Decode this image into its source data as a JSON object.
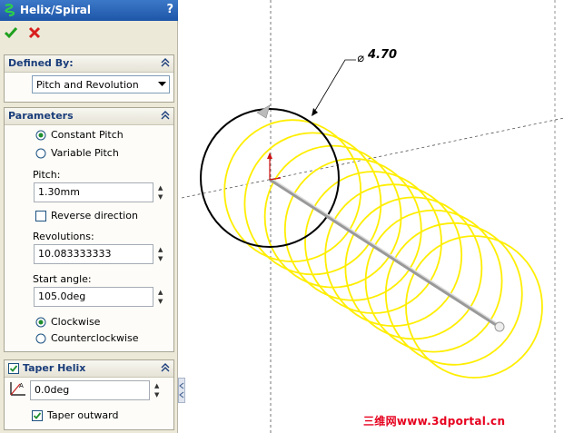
{
  "panel": {
    "title": "Helix/Spiral",
    "help": "?",
    "defined_by": {
      "heading": "Defined By:",
      "selected": "Pitch and Revolution"
    },
    "parameters": {
      "heading": "Parameters",
      "constant_pitch": "Constant Pitch",
      "variable_pitch": "Variable Pitch",
      "pitch_label": "Pitch:",
      "pitch_value": "1.30mm",
      "reverse_label": "Reverse direction",
      "revolutions_label": "Revolutions:",
      "revolutions_value": "10.083333333",
      "start_angle_label": "Start angle:",
      "start_angle_value": "105.0deg",
      "clockwise": "Clockwise",
      "counterclockwise": "Counterclockwise"
    },
    "taper": {
      "heading": "Taper Helix",
      "angle_value": "0.0deg",
      "outward_label": "Taper outward"
    }
  },
  "viewport": {
    "dimension_label": "4.70",
    "helix_color": "#ffee00"
  },
  "watermark": "三维网www.3dportal.cn"
}
